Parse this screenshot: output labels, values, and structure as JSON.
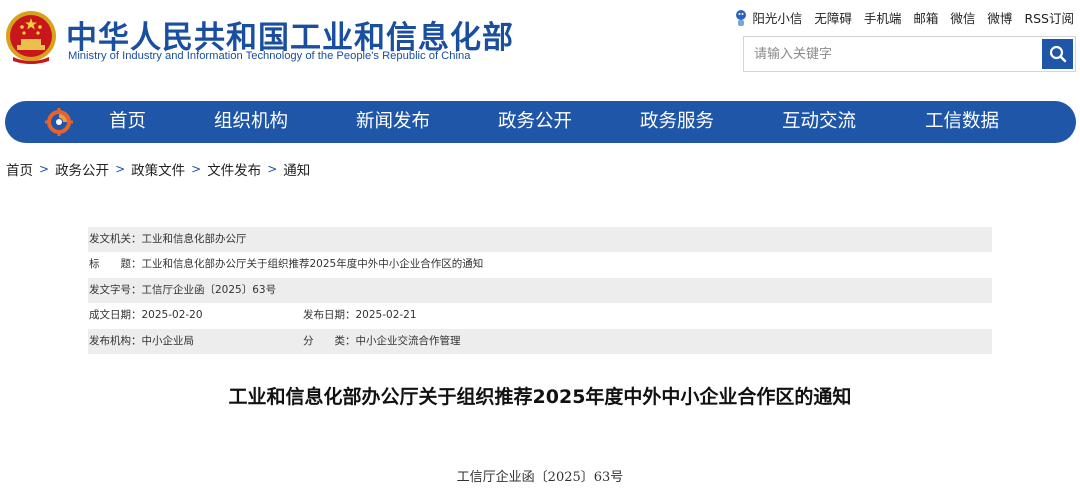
{
  "header": {
    "title": "中华人民共和国工业和信息化部",
    "subtitle": "Ministry of Industry and Information Technology of the People's Republic of China",
    "top_links": [
      "阳光小信",
      "无障碍",
      "手机端",
      "邮箱",
      "微信",
      "微博",
      "RSS订阅"
    ],
    "search": {
      "placeholder": "请输入关键字",
      "value": ""
    }
  },
  "nav": {
    "items": [
      "首页",
      "组织机构",
      "新闻发布",
      "政务公开",
      "政务服务",
      "互动交流",
      "工信数据"
    ]
  },
  "breadcrumb": [
    "首页",
    "政务公开",
    "政策文件",
    "文件发布",
    "通知"
  ],
  "meta": {
    "issuer_label": "发文机关：",
    "issuer": "工业和信息化部办公厅",
    "title_label": "标　　题：",
    "title": "工业和信息化部办公厅关于组织推荐2025年度中外中小企业合作区的通知",
    "doc_no_label": "发文字号：",
    "doc_no": "工信厅企业函〔2025〕63号",
    "created_label": "成文日期：",
    "created": "2025-02-20",
    "published_label": "发布日期：",
    "published": "2025-02-21",
    "org_label": "发布机构：",
    "org": "中小企业局",
    "category_label": "分　　类：",
    "category": "中小企业交流合作管理"
  },
  "document": {
    "title": "工业和信息化部办公厅关于组织推荐2025年度中外中小企业合作区的通知",
    "number": "工信厅企业函〔2025〕63号"
  },
  "colors": {
    "brand_blue": "#1f56a8",
    "title_blue": "#1a4fa0",
    "row_shade": "#ededed"
  }
}
